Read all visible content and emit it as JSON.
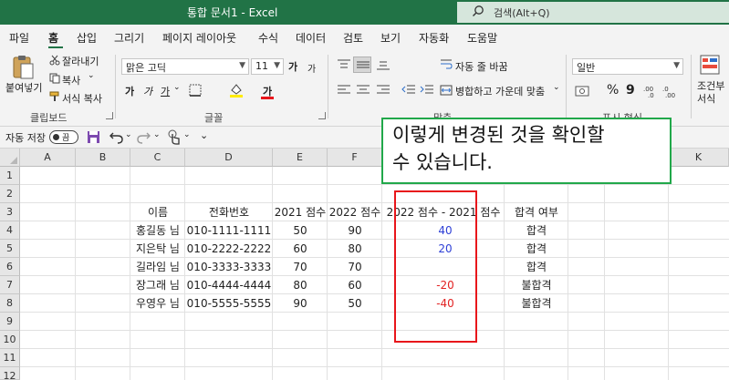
{
  "titlebar": {
    "title": "통합 문서1  -  Excel",
    "search_placeholder": "검색(Alt+Q)"
  },
  "menu": {
    "tabs": [
      "파일",
      "홈",
      "삽입",
      "그리기",
      "페이지 레이아웃",
      "수식",
      "데이터",
      "검토",
      "보기",
      "자동화",
      "도움말"
    ],
    "active": "홈"
  },
  "ribbon": {
    "paste": "붙여넣기",
    "cut": "잘라내기",
    "copy": "복사",
    "format_painter": "서식 복사",
    "clipboard_label": "클립보드",
    "font_name": "맑은 고딕",
    "font_size": "11",
    "font_label": "글꼴",
    "wrap_text": "자동 줄 바꿈",
    "merge_center": "병합하고 가운데 맞춤",
    "align_label": "맞춤",
    "number_format": "일반",
    "number_label": "표시 형식",
    "conditional": "조건부",
    "conditional2": "서식",
    "bold": "가",
    "italic": "가",
    "underline": "가",
    "grow_font": "가",
    "shrink_font": "가",
    "font_color_glyph": "가",
    "percent": "%",
    "comma": "9"
  },
  "qat": {
    "autosave": "자동 저장",
    "toggle": "끔"
  },
  "sheet": {
    "columns": [
      "A",
      "B",
      "C",
      "D",
      "E",
      "F",
      "G",
      "H",
      "I",
      "J",
      "K"
    ],
    "rows": [
      "1",
      "2",
      "3",
      "4",
      "5",
      "6",
      "7",
      "8",
      "9",
      "10",
      "11",
      "12"
    ],
    "headers": {
      "name": "이름",
      "phone": "전화번호",
      "y2021": "2021 점수",
      "y2022": "2022 점수",
      "diff": "2022 점수 - 2021 점수",
      "result": "합격 여부"
    },
    "data": [
      {
        "name": "홍길동 님",
        "phone": "010-1111-1111",
        "s2021": "50",
        "s2022": "90",
        "diff": "40",
        "result": "합격"
      },
      {
        "name": "지은탁 님",
        "phone": "010-2222-2222",
        "s2021": "60",
        "s2022": "80",
        "diff": "20",
        "result": "합격"
      },
      {
        "name": "길라임 님",
        "phone": "010-3333-3333",
        "s2021": "70",
        "s2022": "70",
        "diff": "",
        "result": "합격"
      },
      {
        "name": "장그래 님",
        "phone": "010-4444-4444",
        "s2021": "80",
        "s2022": "60",
        "diff": "-20",
        "result": "불합격"
      },
      {
        "name": "우영우 님",
        "phone": "010-5555-5555",
        "s2021": "90",
        "s2022": "50",
        "diff": "-40",
        "result": "불합격"
      }
    ]
  },
  "callout": {
    "line1": "이렇게 변경된 것을 확인할",
    "line2": "수 있습니다."
  },
  "colors": {
    "excel_green": "#217346",
    "positive": "#2e3fd6",
    "negative": "#e22222",
    "highlight": "#e8161b",
    "callout_border": "#21a84a"
  }
}
